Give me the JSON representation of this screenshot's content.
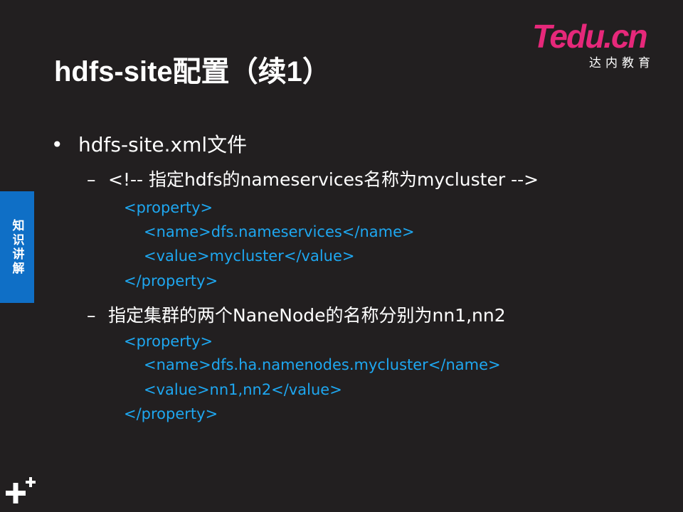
{
  "title": "hdfs-site配置（续1）",
  "logo": {
    "brand": "Tedu.cn",
    "subtitle": "达内教育"
  },
  "side_tab": {
    "label": "知识讲解"
  },
  "bullets": {
    "main": "hdfs-site.xml文件",
    "sub1": {
      "text": "<!-- 指定hdfs的nameservices名称为mycluster  -->",
      "code": [
        "<property>",
        "<name>dfs.nameservices</name>",
        "<value>mycluster</value>",
        "</property>"
      ]
    },
    "sub2": {
      "text": "指定集群的两个NaneNode的名称分别为nn1,nn2",
      "code": [
        "<property>",
        "<name>dfs.ha.namenodes.mycluster</name>",
        "<value>nn1,nn2</value>",
        "</property>"
      ]
    }
  },
  "colors": {
    "background": "#221f20",
    "code": "#1ea7f0",
    "side_tab": "#0f6fc6",
    "brand": "#e6287a"
  },
  "icons": {
    "bullet": "•",
    "dash": "–",
    "corner": "plus-icon"
  }
}
